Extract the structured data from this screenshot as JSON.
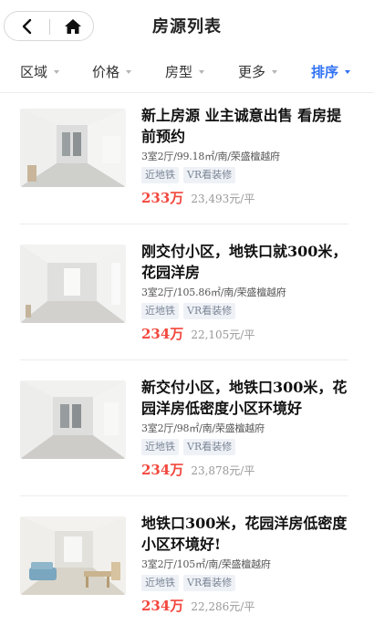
{
  "header": {
    "title": "房源列表"
  },
  "filters": [
    {
      "label": "区域",
      "active": false
    },
    {
      "label": "价格",
      "active": false
    },
    {
      "label": "房型",
      "active": false
    },
    {
      "label": "更多",
      "active": false
    },
    {
      "label": "排序",
      "active": true
    }
  ],
  "colors": {
    "accent": "#3072f6",
    "price": "#f2473d",
    "tag_bg": "#eef1f6",
    "tag_text": "#7a8696"
  },
  "listings": [
    {
      "title": "新上房源 业主诚意出售 看房提前预约",
      "meta": "3室2厅/99.18㎡/南/荣盛檀越府",
      "tags": [
        "近地铁",
        "VR看装修"
      ],
      "price": "233万",
      "unit_price": "23,493元/平"
    },
    {
      "title": "刚交付小区，地铁口就300米，花园洋房",
      "meta": "3室2厅/105.86㎡/南/荣盛檀越府",
      "tags": [
        "近地铁",
        "VR看装修"
      ],
      "price": "234万",
      "unit_price": "22,105元/平"
    },
    {
      "title": "新交付小区，地铁口300米，花园洋房低密度小区环境好",
      "meta": "3室2厅/98㎡/南/荣盛檀越府",
      "tags": [
        "近地铁",
        "VR看装修"
      ],
      "price": "234万",
      "unit_price": "23,878元/平"
    },
    {
      "title": "地铁口300米，花园洋房低密度小区环境好!",
      "meta": "3室2厅/105㎡/南/荣盛檀越府",
      "tags": [
        "近地铁",
        "VR看装修"
      ],
      "price": "234万",
      "unit_price": "22,286元/平"
    }
  ]
}
